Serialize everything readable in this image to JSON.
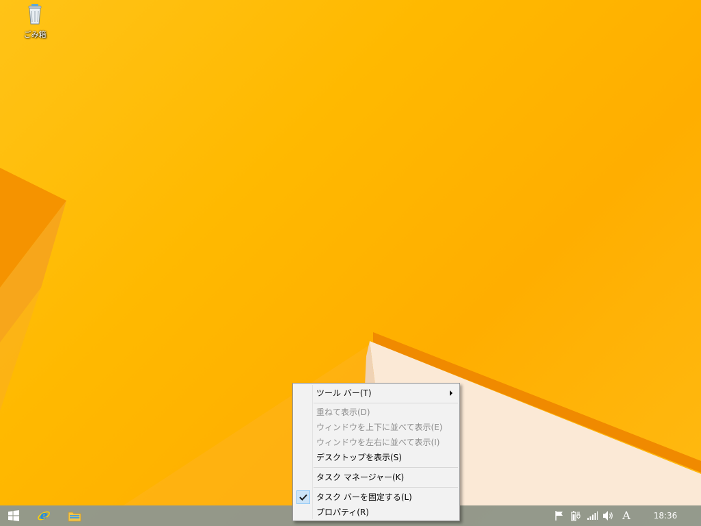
{
  "desktop": {
    "icons": [
      {
        "label": "ごみ箱",
        "icon": "recycle-bin-icon"
      }
    ]
  },
  "context_menu": {
    "items": [
      {
        "label": "ツール バー(T)",
        "enabled": true,
        "submenu": true
      },
      {
        "label": "重ねて表示(D)",
        "enabled": false
      },
      {
        "label": "ウィンドウを上下に並べて表示(E)",
        "enabled": false
      },
      {
        "label": "ウィンドウを左右に並べて表示(I)",
        "enabled": false
      },
      {
        "label": "デスクトップを表示(S)",
        "enabled": true
      },
      {
        "label": "タスク マネージャー(K)",
        "enabled": true
      },
      {
        "label": "タスク バーを固定する(L)",
        "enabled": true,
        "checked": true
      },
      {
        "label": "プロパティ(R)",
        "enabled": true
      }
    ]
  },
  "taskbar": {
    "pinned": [
      {
        "icon": "windows-start-icon"
      },
      {
        "icon": "internet-explorer-icon"
      },
      {
        "icon": "file-explorer-icon"
      }
    ],
    "tray": [
      {
        "icon": "action-center-flag-icon"
      },
      {
        "icon": "power-battery-icon"
      },
      {
        "icon": "network-signal-icon"
      },
      {
        "icon": "volume-icon"
      }
    ],
    "ime_indicator": "A",
    "clock": "18:36"
  },
  "colors": {
    "wallpaper_yellow": "#ffb900",
    "wallpaper_orange": "#f28c00",
    "taskbar": "#7691af",
    "menu_bg": "#f2f2f2",
    "menu_disabled_text": "#8d8d8d",
    "check_highlight": "#cde4f7"
  }
}
